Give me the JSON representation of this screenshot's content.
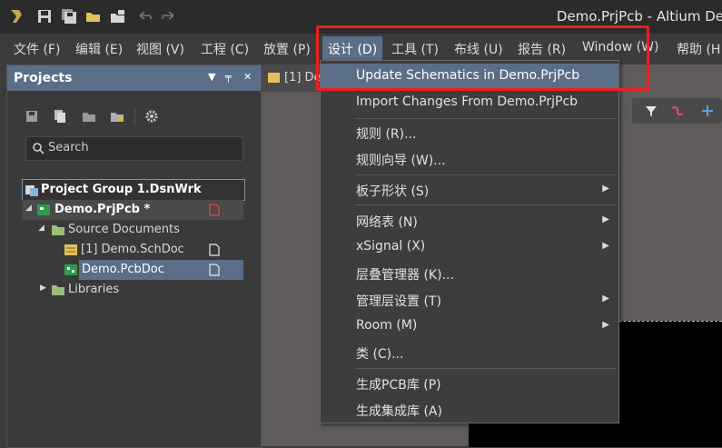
{
  "titlebar": {
    "title": "Demo.PrjPcb - Altium De"
  },
  "menubar": {
    "items": [
      {
        "label": "文件 (F)"
      },
      {
        "label": "编辑 (E)"
      },
      {
        "label": "视图 (V)"
      },
      {
        "label": "工程 (C)"
      },
      {
        "label": "放置 (P)"
      },
      {
        "label": "设计 (D)"
      },
      {
        "label": "工具 (T)"
      },
      {
        "label": "布线 (U)"
      },
      {
        "label": "报告 (R)"
      },
      {
        "label": "Window (W)"
      },
      {
        "label": "帮助 (H"
      }
    ]
  },
  "projects_panel": {
    "title": "Projects",
    "search_placeholder": "Search",
    "tree": [
      {
        "label": "Project Group 1.DsnWrk"
      },
      {
        "label": "Demo.PrjPcb *"
      },
      {
        "label": "Source Documents"
      },
      {
        "label": "[1] Demo.SchDoc"
      },
      {
        "label": "Demo.PcbDoc"
      },
      {
        "label": "Libraries"
      }
    ]
  },
  "document": {
    "tab_label": "[1] De"
  },
  "design_menu": {
    "items": [
      {
        "label": "Update Schematics in Demo.PrjPcb",
        "submenu": false
      },
      {
        "label": "Import Changes From Demo.PrjPcb",
        "submenu": false
      },
      {
        "label": "规则 (R)...",
        "submenu": false
      },
      {
        "label": "规则向导 (W)...",
        "submenu": false
      },
      {
        "label": "板子形状 (S)",
        "submenu": true
      },
      {
        "label": "网络表 (N)",
        "submenu": true
      },
      {
        "label": "xSignal (X)",
        "submenu": true
      },
      {
        "label": "层叠管理器 (K)...",
        "submenu": false
      },
      {
        "label": "管理层设置 (T)",
        "submenu": true
      },
      {
        "label": "Room (M)",
        "submenu": true
      },
      {
        "label": "类 (C)...",
        "submenu": false
      },
      {
        "label": "生成PCB库 (P)",
        "submenu": false
      },
      {
        "label": "生成集成库 (A)",
        "submenu": false
      }
    ]
  },
  "colors": {
    "accent": "#5a6e87",
    "highlight_box": "#e8211f",
    "background": "#3c3c3c"
  }
}
